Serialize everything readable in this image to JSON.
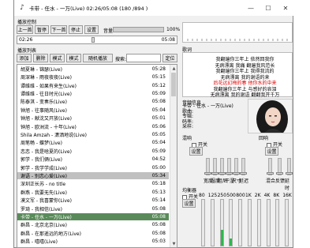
{
  "title": {
    "text": "卡带 - 任水 - 一万(Live)  02:26/05:08   (180 /894 )"
  },
  "window_controls": {
    "min": "—",
    "max": "☐",
    "close": "✕"
  },
  "playback": {
    "section_label": "播放控制",
    "buttons": [
      "上一首",
      "暂停",
      "下一首",
      "停止",
      "设置"
    ],
    "volume_label": "音量",
    "volume_value": "100%",
    "volume_level": 1.0,
    "position": "02:26",
    "duration": "05:08",
    "progress": 0.474
  },
  "list": {
    "section_label": "播放列表",
    "buttons": [
      "添加",
      "删除",
      "模式",
      "模式",
      "随机播放"
    ],
    "search_label": "搜索:",
    "locate_label": "定位",
    "rows": [
      {
        "title": "胡夏琳 - 锦瑟(Live)",
        "dur": "05:28"
      },
      {
        "title": "周深琳 - 雨夜夜夜(Live)",
        "dur": "05:15"
      },
      {
        "title": "谭维维 - 如果有来生(Live)",
        "dur": "05:12"
      },
      {
        "title": "谭维维 - 往日时光(Live)",
        "dur": "05:09"
      },
      {
        "title": "陈泰淇 - 变奏乐(Live)",
        "dur": "05:08"
      },
      {
        "title": "钟旭 - 往事随风(Live)",
        "dur": "05:04"
      },
      {
        "title": "钟旭 - 献沈又开放(Live)",
        "dur": "05:01"
      },
      {
        "title": "钟旭 - 欧洲流 - 十年(Live)",
        "dur": "05:06"
      },
      {
        "title": "Shila Amzah - 潇洒地说(Live)",
        "dur": "05:05"
      },
      {
        "title": "周笔畅 - 蝶梦(Live)",
        "dur": "05:04"
      },
      {
        "title": "恋恋 - 我是啥夏的(Live)",
        "dur": "05:09"
      },
      {
        "title": "郭学 - 我们俩(Live)",
        "dur": "04:52"
      },
      {
        "title": "郭学 - 我学学成(Live)",
        "dur": "05:00"
      },
      {
        "title": "谢语 - 别恋心爱(Live)",
        "dur": "05:34"
      },
      {
        "title": "深圳正长苏 - no title",
        "dur": "05:18"
      },
      {
        "title": "群燕 - 我要无先(Live)",
        "dur": "05:13"
      },
      {
        "title": "漠文军 - 我喜蒙你(Live)",
        "dur": "05:14"
      },
      {
        "title": "罗琦 - 我相信(Live)",
        "dur": "05:08"
      },
      {
        "title": "卡带 - 任水 - 一万(Live)",
        "dur": "05:08"
      },
      {
        "title": "群昌 - 北京北京(Live)",
        "dur": "05:08"
      },
      {
        "title": "群昌 - 在那遥远的地方(Live)",
        "dur": "05:08"
      },
      {
        "title": "群昌 - 嘻嘻(Live)",
        "dur": "05:03"
      }
    ],
    "selected_index": 13,
    "current_index": 18
  },
  "lyrics": {
    "section_label": "歌词",
    "lines": [
      {
        "text": "我翻遍你三年上 依然回我你",
        "color": "#000000"
      },
      {
        "text": "无病漂离 我痛 翻遍我风范长",
        "color": "#000000"
      },
      {
        "text": "我翻遍你三年上 我得我流的",
        "color": "#000000"
      },
      {
        "text": "无病漂离 我的谢语的来",
        "color": "#000000"
      },
      {
        "text": "后花远幻梅的春 他你水的中来",
        "color": "#e00000"
      },
      {
        "text": "我翻遍你三年上 与感好的哀泪",
        "color": "#000000"
      },
      {
        "text": "无病漂离 我的谢语 翻翻我开千万",
        "color": "#000000"
      }
    ]
  },
  "info": {
    "section_label": "音频信息",
    "lines": [
      "卡带 - 任水 - 一万(Live)",
      "歌曲:",
      "专辑:",
      "码率:",
      "采样:"
    ]
  },
  "effects": {
    "reverb_label": "混响",
    "reverb_toggle": "开关",
    "reverb_button": "设置",
    "reverb_sliders": [
      "宽度",
      "湿度",
      "阻尼",
      "干湿",
      "尺寸",
      "延迟"
    ],
    "echo_label": "回响",
    "echo_toggle": "开关",
    "echo_button": "设置",
    "echo_sliders": [
      "混合",
      "反馈",
      "延时"
    ],
    "echo_bottom": "时间",
    "echo_right": "范围"
  },
  "equalizer": {
    "section_label": "均衡器",
    "toggle": "开关",
    "button": "设置",
    "bands": [
      "80",
      "125",
      "250",
      "500",
      "800",
      "1K",
      "2K",
      "4K",
      "8K",
      "16K"
    ],
    "levels": [
      0.0,
      0.0,
      0.35,
      0.15,
      0.0,
      0.0,
      0.0,
      0.0,
      0.0,
      0.0
    ]
  }
}
